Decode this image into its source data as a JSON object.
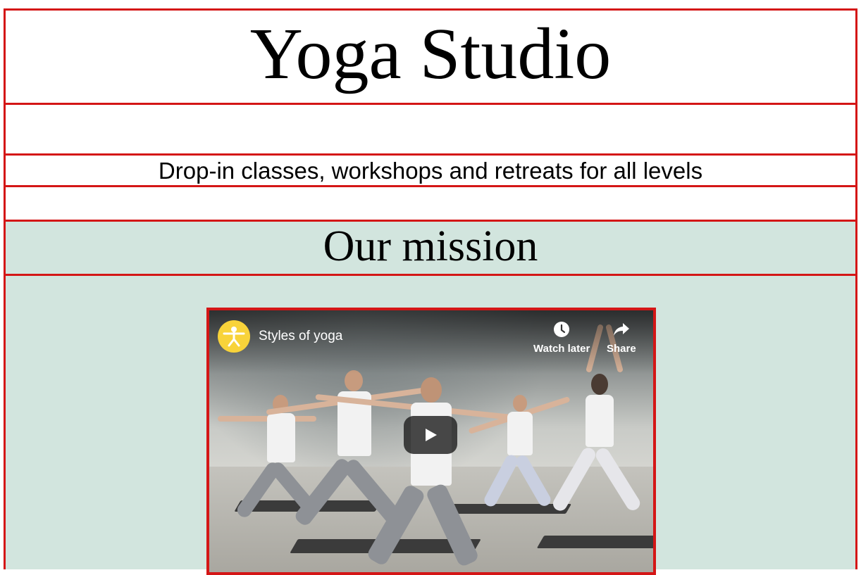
{
  "header": {
    "title": "Yoga Studio",
    "tagline": "Drop-in classes, workshops and retreats for all levels"
  },
  "mission": {
    "heading": "Our mission"
  },
  "video": {
    "title": "Styles of yoga",
    "watch_later_label": "Watch later",
    "share_label": "Share",
    "channel_icon": "yoga-person-icon",
    "play_icon": "play-icon"
  },
  "colors": {
    "border": "#d41616",
    "mission_background": "#d2e5de",
    "channel_avatar": "#f8d33a"
  }
}
